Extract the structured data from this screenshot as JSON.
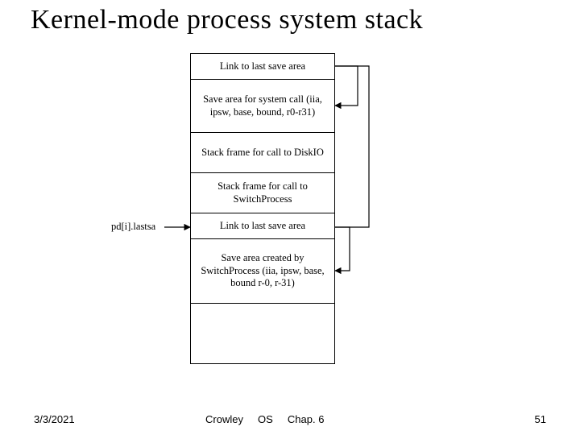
{
  "title": "Kernel-mode process system stack",
  "side_label": "pd[i].lastsa",
  "stack": {
    "cells": [
      "Link to last save area",
      "Save area for system call (iia, ipsw, base, bound, r0-r31)",
      "Stack frame for call to DiskIO",
      "Stack frame for call to SwitchProcess",
      "Link to last save area",
      "Save area created by SwitchProcess (iia, ipsw, base, bound r-0, r-31)",
      ""
    ]
  },
  "footer": {
    "date": "3/3/2021",
    "author": "Crowley",
    "course": "OS",
    "chapter": "Chap. 6",
    "page": "51"
  }
}
